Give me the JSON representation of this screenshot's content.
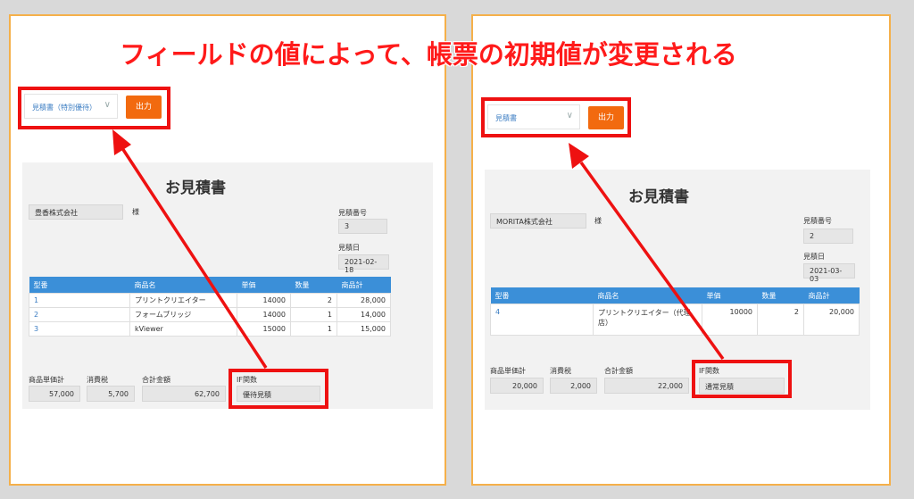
{
  "headline": "フィールドの値によって、帳票の初期値が変更される",
  "colors": {
    "accent_red": "#ee1111",
    "button_orange": "#f26a0f",
    "table_header_blue": "#3b8fd8",
    "panel_border": "#f5b04a"
  },
  "left": {
    "select_value": "見積書（特別優待）",
    "output_button": "出力",
    "form_title": "お見積書",
    "customer": "豊香株式会社",
    "sama": "様",
    "estimate_no_label": "見積番号",
    "estimate_no": "3",
    "estimate_date_label": "見積日",
    "estimate_date": "2021-02-18",
    "table": {
      "headers": [
        "型番",
        "商品名",
        "単価",
        "数量",
        "商品計"
      ],
      "rows": [
        [
          "1",
          "プリントクリエイター",
          "14000",
          "2",
          "28,000"
        ],
        [
          "2",
          "フォームブリッジ",
          "14000",
          "1",
          "14,000"
        ],
        [
          "3",
          "kViewer",
          "15000",
          "1",
          "15,000"
        ]
      ]
    },
    "subtotal_label": "商品単価計",
    "subtotal": "57,000",
    "tax_label": "消費税",
    "tax": "5,700",
    "total_label": "合計金額",
    "total": "62,700",
    "if_label": "IF関数",
    "if_value": "優待見積"
  },
  "right": {
    "select_value": "見積書",
    "output_button": "出力",
    "form_title": "お見積書",
    "customer": "MORITA株式会社",
    "sama": "様",
    "estimate_no_label": "見積番号",
    "estimate_no": "2",
    "estimate_date_label": "見積日",
    "estimate_date": "2021-03-03",
    "table": {
      "headers": [
        "型番",
        "商品名",
        "単価",
        "数量",
        "商品計"
      ],
      "rows": [
        [
          "4",
          "プリントクリエイター（代理店）",
          "10000",
          "2",
          "20,000"
        ]
      ]
    },
    "subtotal_label": "商品単価計",
    "subtotal": "20,000",
    "tax_label": "消費税",
    "tax": "2,000",
    "total_label": "合計金額",
    "total": "22,000",
    "if_label": "IF関数",
    "if_value": "通常見積"
  }
}
